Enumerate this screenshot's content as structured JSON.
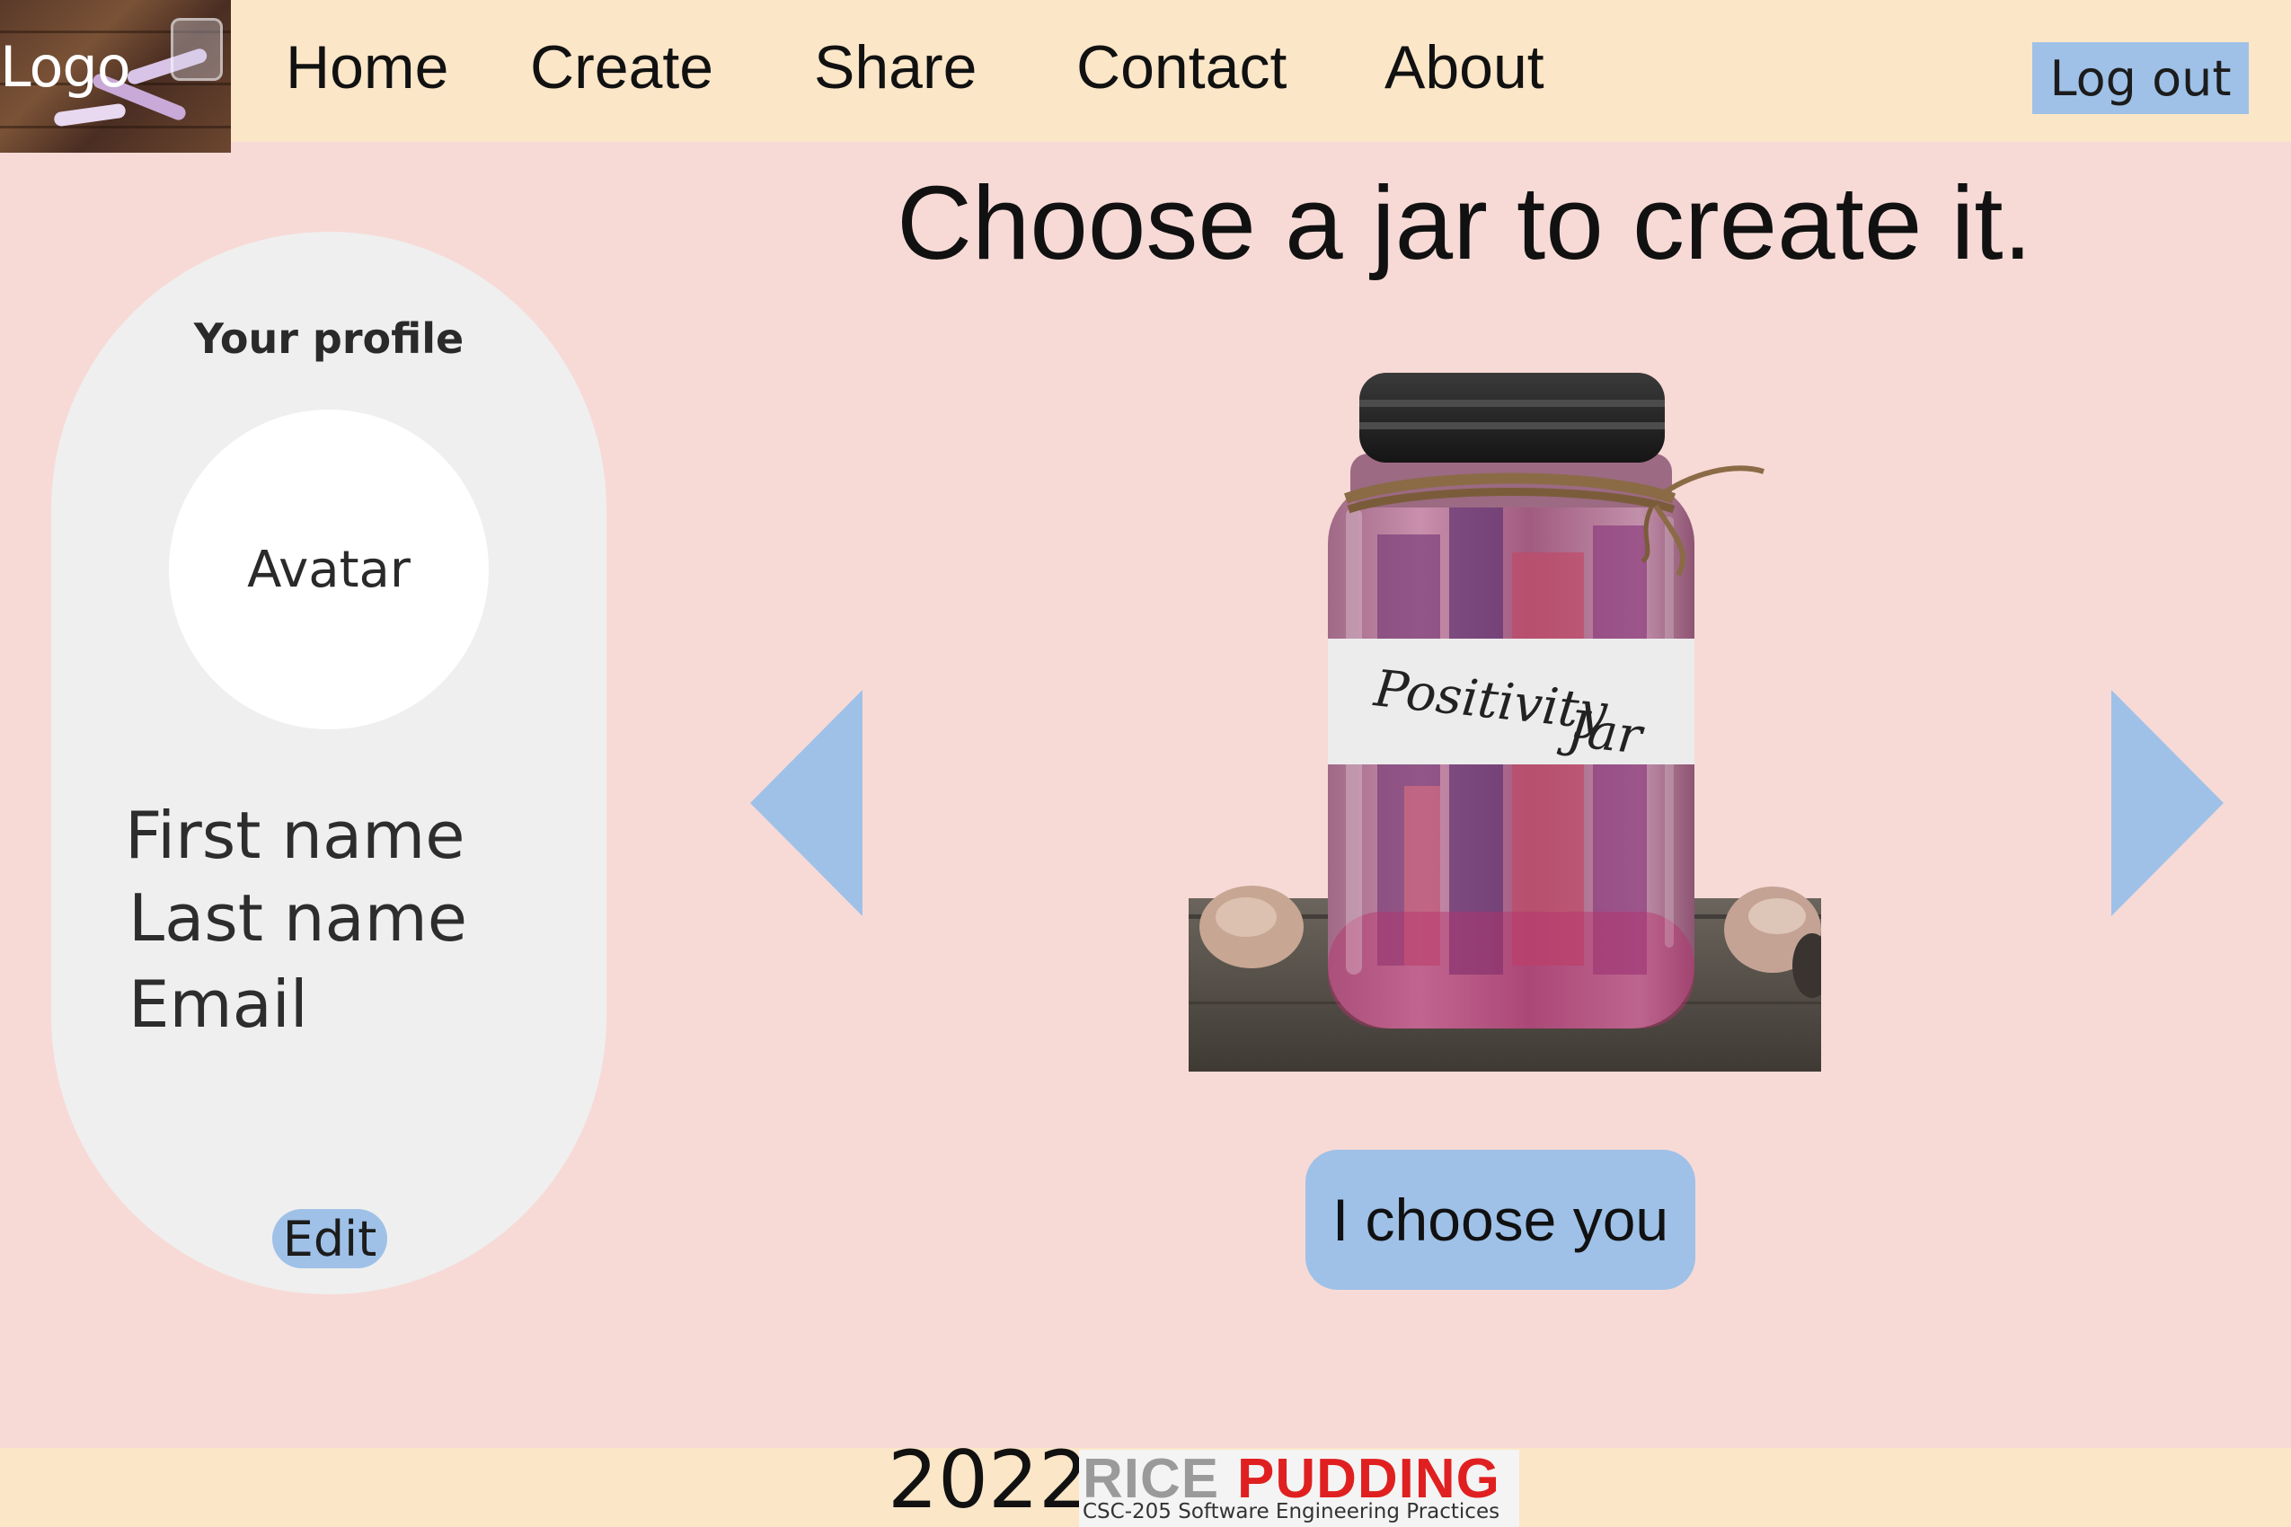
{
  "header": {
    "logo_label": "Logo",
    "nav": [
      {
        "label": "Home"
      },
      {
        "label": "Create"
      },
      {
        "label": "Share"
      },
      {
        "label": "Contact"
      },
      {
        "label": "About"
      }
    ],
    "logout_label": "Log out"
  },
  "main": {
    "title": "Choose a jar to create it.",
    "jar_label_line1": "Positivity",
    "jar_label_line2": "Jar",
    "choose_button": "I choose you",
    "prev_arrow_icon": "triangle-left-icon",
    "next_arrow_icon": "triangle-right-icon"
  },
  "profile": {
    "heading": "Your profile",
    "avatar_label": "Avatar",
    "first_name": "First name",
    "last_name": "Last name",
    "email": "Email",
    "edit_label": "Edit"
  },
  "footer": {
    "year": "2022",
    "brand_word1": "RICE",
    "brand_word2": "PUDDING",
    "brand_subtitle": "CSC-205 Software Engineering Practices"
  },
  "colors": {
    "background": "#f7dad6",
    "header_footer": "#fbe6c8",
    "accent_blue": "#9fc1e8",
    "card": "#efefef",
    "brand_red": "#e02020",
    "brand_grey": "#9a9a9a"
  }
}
